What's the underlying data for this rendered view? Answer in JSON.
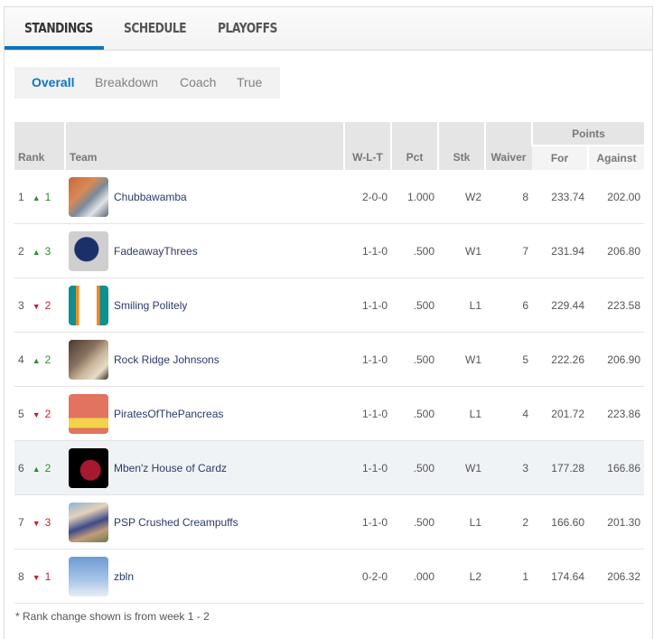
{
  "tabs": [
    {
      "label": "STANDINGS",
      "active": true
    },
    {
      "label": "SCHEDULE",
      "active": false
    },
    {
      "label": "PLAYOFFS",
      "active": false
    }
  ],
  "subtabs": [
    {
      "label": "Overall",
      "active": true
    },
    {
      "label": "Breakdown",
      "active": false
    },
    {
      "label": "Coach",
      "active": false
    },
    {
      "label": "True",
      "active": false
    }
  ],
  "table": {
    "headers": {
      "rank": "Rank",
      "team": "Team",
      "wlt": "W-L-T",
      "pct": "Pct",
      "stk": "Stk",
      "waiver": "Waiver",
      "points": "Points",
      "for": "For",
      "against": "Against"
    },
    "rows": [
      {
        "rank": "1",
        "dir": "up",
        "change": "1",
        "team": "Chubbawamba",
        "avatar": "photo-newspaper",
        "wlt": "2-0-0",
        "pct": "1.000",
        "stk": "W2",
        "waiver": "8",
        "for": "233.74",
        "against": "202.00"
      },
      {
        "rank": "2",
        "dir": "up",
        "change": "3",
        "team": "FadeawayThrees",
        "avatar": "nfl-helmet",
        "wlt": "1-1-0",
        "pct": ".500",
        "stk": "W1",
        "waiver": "7",
        "for": "231.94",
        "against": "206.80"
      },
      {
        "rank": "3",
        "dir": "down",
        "change": "2",
        "team": "Smiling Politely",
        "avatar": "dolphins-stripes",
        "wlt": "1-1-0",
        "pct": ".500",
        "stk": "L1",
        "waiver": "6",
        "for": "229.44",
        "against": "223.58"
      },
      {
        "rank": "4",
        "dir": "up",
        "change": "2",
        "team": "Rock Ridge Johnsons",
        "avatar": "photo-two-men",
        "wlt": "1-1-0",
        "pct": ".500",
        "stk": "W1",
        "waiver": "5",
        "for": "222.26",
        "against": "206.90"
      },
      {
        "rank": "5",
        "dir": "down",
        "change": "2",
        "team": "PiratesOfThePancreas",
        "avatar": "pirate-skull",
        "wlt": "1-1-0",
        "pct": ".500",
        "stk": "L1",
        "waiver": "4",
        "for": "201.72",
        "against": "223.86"
      },
      {
        "rank": "6",
        "dir": "up",
        "change": "2",
        "team": "Mben'z House of Cardz",
        "avatar": "cardinal-logo",
        "wlt": "1-1-0",
        "pct": ".500",
        "stk": "W1",
        "waiver": "3",
        "for": "177.28",
        "against": "166.86",
        "highlight": true
      },
      {
        "rank": "7",
        "dir": "down",
        "change": "3",
        "team": "PSP Crushed Creampuffs",
        "avatar": "photo-man-hat",
        "wlt": "1-1-0",
        "pct": ".500",
        "stk": "L1",
        "waiver": "2",
        "for": "166.60",
        "against": "201.30"
      },
      {
        "rank": "8",
        "dir": "down",
        "change": "1",
        "team": "zbln",
        "avatar": "sky-clouds",
        "wlt": "0-2-0",
        "pct": ".000",
        "stk": "L2",
        "waiver": "1",
        "for": "174.64",
        "against": "206.32"
      }
    ]
  },
  "footnote": "* Rank change shown is from week 1 - 2",
  "colors": {
    "accent": "#0a76c2",
    "up": "#2e8b3a",
    "down": "#c8202a",
    "team_link": "#2a3a6a"
  }
}
